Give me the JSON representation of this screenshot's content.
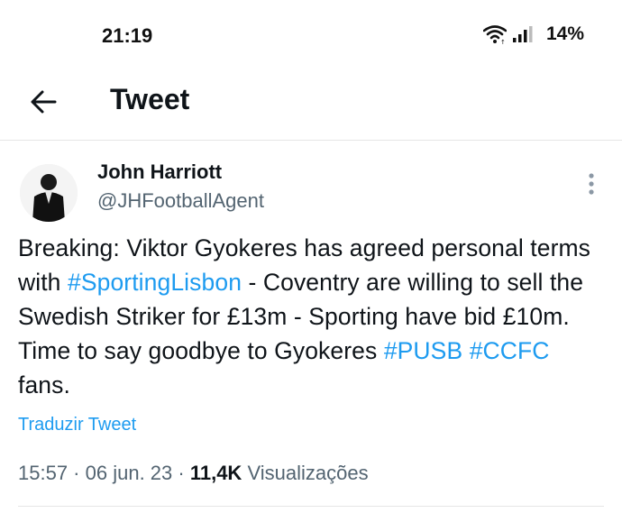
{
  "status_bar": {
    "time": "21:19",
    "battery": "14%"
  },
  "header": {
    "title": "Tweet"
  },
  "tweet": {
    "author_name": "John Harriott",
    "author_handle": "@JHFootballAgent",
    "text": {
      "p1": "Breaking: Viktor Gyokeres has agreed personal terms with ",
      "tag1": "#SportingLisbon",
      "p2": " - Coventry are willing to sell the Swedish Striker for £13m - Sporting have bid £10m. Time to say goodbye to Gyokeres ",
      "tag2": "#PUSB",
      "p3": " ",
      "tag3": "#CCFC",
      "p4": " fans."
    },
    "translate_label": "Traduzir Tweet",
    "time": "15:57",
    "date": "06 jun. 23",
    "separator": " · ",
    "views_count": "11,4K",
    "views_label": "Visualizações"
  },
  "colors": {
    "link": "#1d9bf0",
    "text": "#0f1419",
    "secondary": "#536471"
  },
  "icons": [
    "wifi-icon",
    "signal-icon",
    "back-arrow-icon",
    "more-vertical-icon"
  ]
}
